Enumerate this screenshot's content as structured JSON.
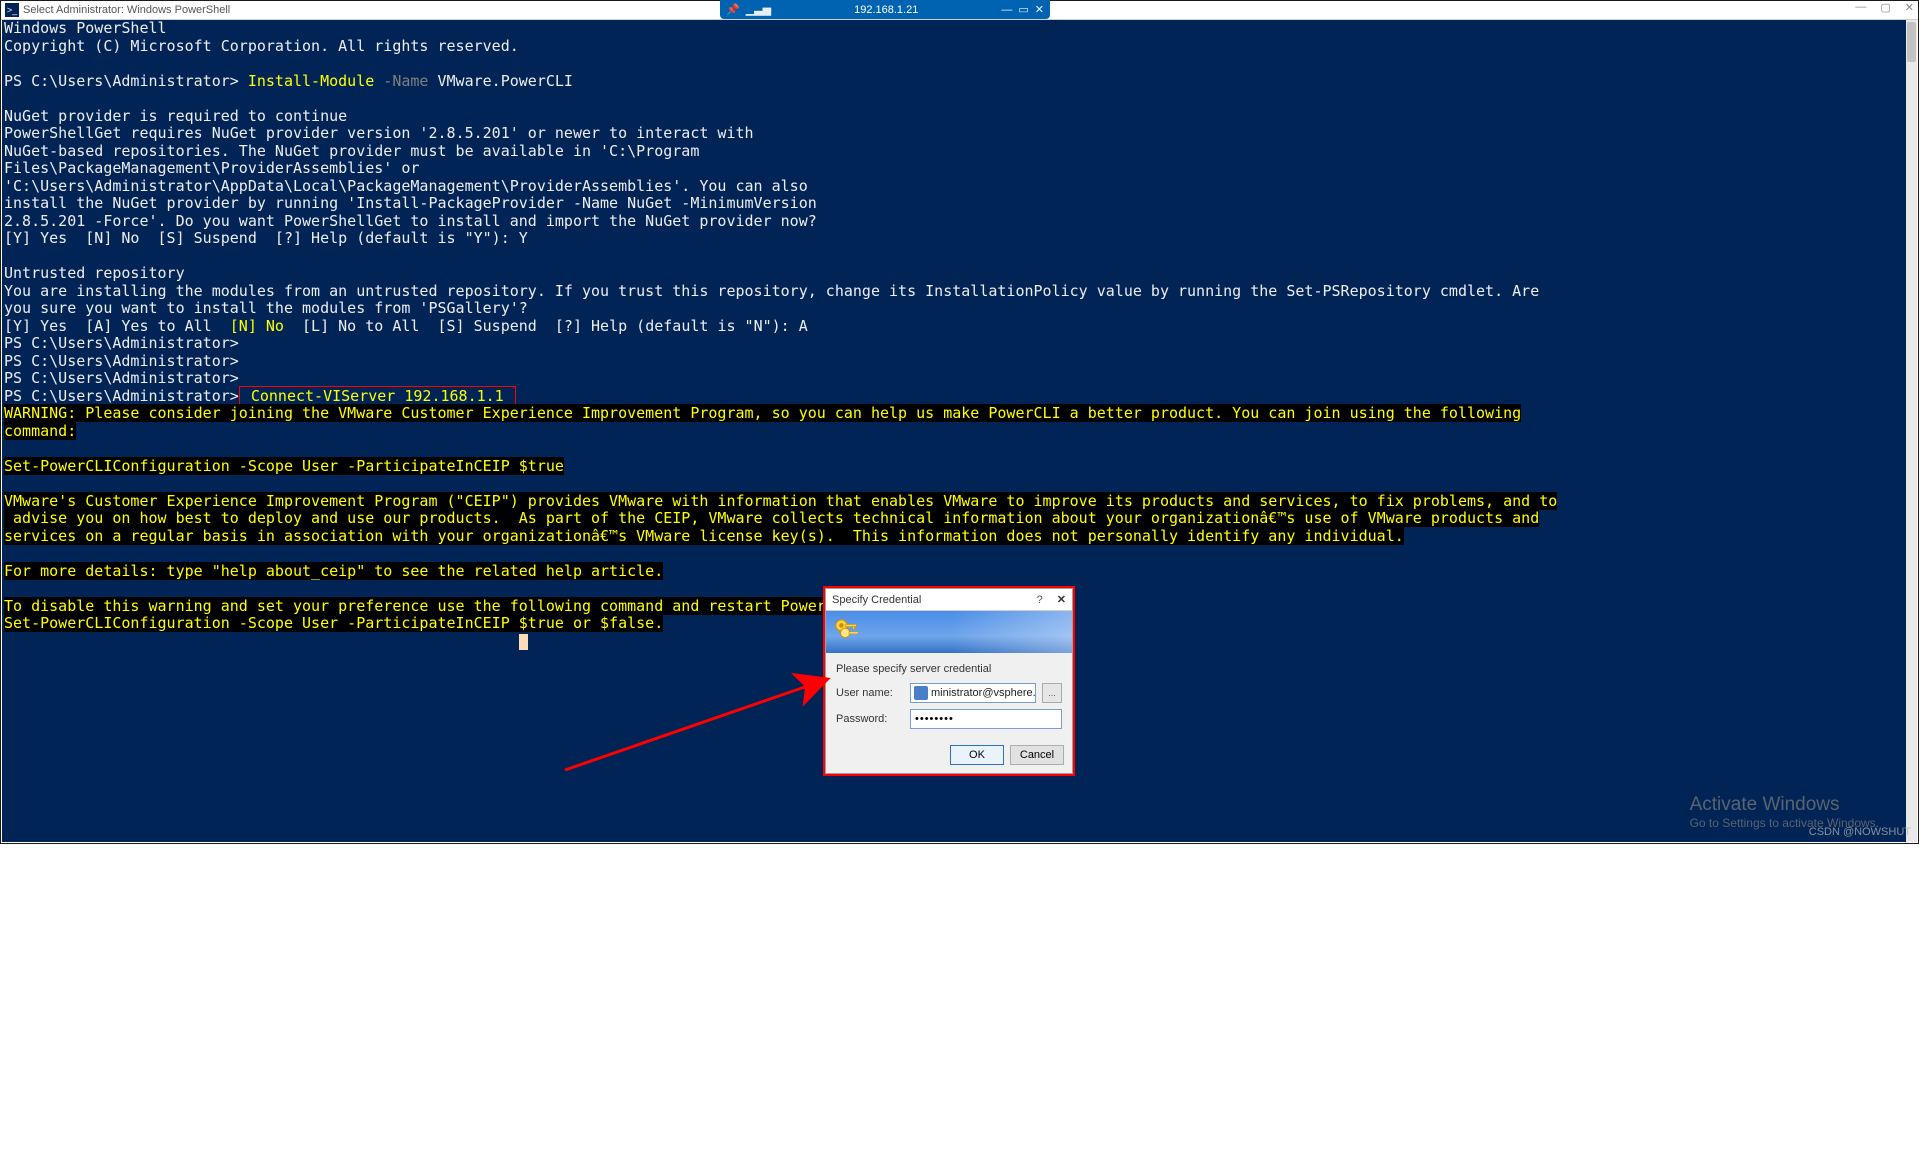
{
  "outer": {
    "title": "Select Administrator: Windows PowerShell"
  },
  "rdp": {
    "ip": "192.168.1.21"
  },
  "terminal": {
    "l1": "Windows PowerShell",
    "l2": "Copyright (C) Microsoft Corporation. All rights reserved.",
    "prompt1": "PS C:\\Users\\Administrator> ",
    "cmd1": "Install-Module",
    "flag1": " -Name",
    "arg1": " VMware.PowerCLI",
    "nuget_block": "NuGet provider is required to continue\nPowerShellGet requires NuGet provider version '2.8.5.201' or newer to interact with\nNuGet-based repositories. The NuGet provider must be available in 'C:\\Program\nFiles\\PackageManagement\\ProviderAssemblies' or\n'C:\\Users\\Administrator\\AppData\\Local\\PackageManagement\\ProviderAssemblies'. You can also\ninstall the NuGet provider by running 'Install-PackageProvider -Name NuGet -MinimumVersion\n2.8.5.201 -Force'. Do you want PowerShellGet to install and import the NuGet provider now?\n[Y] Yes  [N] No  [S] Suspend  [?] Help (default is \"Y\"): Y",
    "untrusted_head": "Untrusted repository",
    "untrusted_body": "You are installing the modules from an untrusted repository. If you trust this repository, change its InstallationPolicy value by running the Set-PSRepository cmdlet. Are\nyou sure you want to install the modules from 'PSGallery'?",
    "untrusted_opts_pre": "[Y] Yes  [A] Yes to All  ",
    "untrusted_opts_no": "[N] No",
    "untrusted_opts_post": "  [L] No to All  [S] Suspend  [?] Help (default is \"N\"): A",
    "prompt_empty": "PS C:\\Users\\Administrator>",
    "cmd2_full": " Connect-VIServer 192.168.1.1 ",
    "warn1": "WARNING: Please consider joining the VMware Customer Experience Improvement Program, so you can help us make PowerCLI a better product. You can join using the following\ncommand:",
    "warn2": "Set-PowerCLIConfiguration -Scope User -ParticipateInCEIP $true",
    "warn3": "VMware's Customer Experience Improvement Program (\"CEIP\") provides VMware with information that enables VMware to improve its products and services, to fix problems, and to\n advise you on how best to deploy and use our products.  As part of the CEIP, VMware collects technical information about your organizationâ€™s use of VMware products and\nservices on a regular basis in association with your organizationâ€™s VMware license key(s).  This information does not personally identify any individual.",
    "warn4": "For more details: type \"help about_ceip\" to see the related help article.",
    "warn5": "To disable this warning and set your preference use the following command and restart PowerShell:\nSet-PowerCLIConfiguration -Scope User -ParticipateInCEIP $true or $false."
  },
  "cred": {
    "title": "Specify Credential",
    "label": "Please specify server credential",
    "user_lbl": "User name:",
    "user_val": "ministrator@vsphere.local",
    "pass_lbl": "Password:",
    "pass_val": "••••••••",
    "ok": "OK",
    "cancel": "Cancel"
  },
  "activate": {
    "h": "Activate Windows",
    "s": "Go to Settings to activate Windows."
  },
  "watermark": "CSDN @NOWSHUT"
}
